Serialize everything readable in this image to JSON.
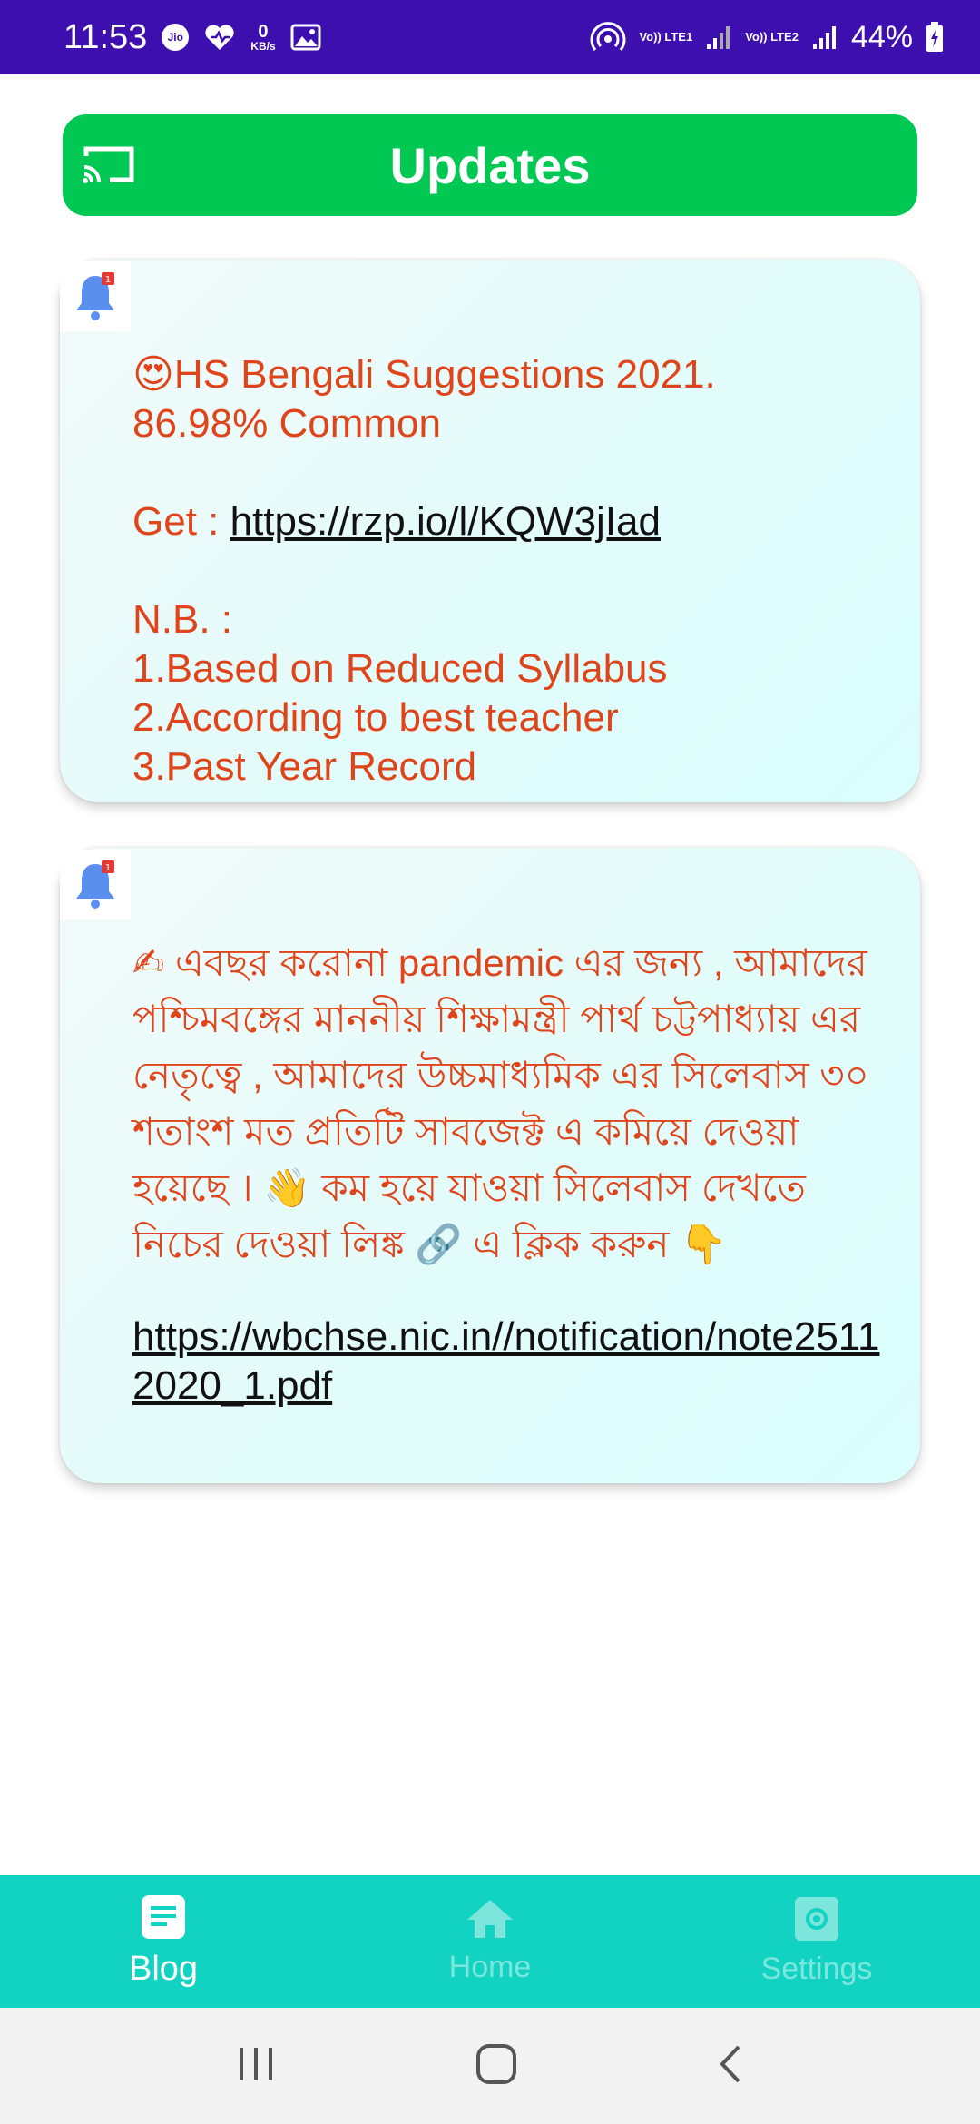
{
  "status_bar": {
    "time": "11:53",
    "jio": "Jio",
    "speed_value": "0",
    "speed_unit": "KB/s",
    "lte1": "Vo)) LTE1",
    "lte2": "Vo)) LTE2",
    "battery": "44%"
  },
  "header": {
    "title": "Updates",
    "cast_icon": "cast-icon"
  },
  "posts": [
    {
      "emoji": "😍",
      "line1": "HS Bengali Suggestions 2021.",
      "line2": "86.98% Common",
      "get_label": "Get : ",
      "link": "https://rzp.io/l/KQW3jIad",
      "nb": "N.B. :",
      "point1": "1.Based on Reduced Syllabus",
      "point2": "2.According to best teacher",
      "point3": "3.Past Year Record"
    },
    {
      "text_a": "✍ এবছর করোনা pandemic এর জন্য , আমাদের পশ্চিমবঙ্গের মাননীয় শিক্ষামন্ত্রী পার্থ চট্টপাধ্যায় এর নেতৃত্বে , আমাদের উচ্চমাধ্যমিক এর সিলেবাস ৩০ শতাংশ মত প্রতিটি সাবজেক্ট এ কমিয়ে দেওয়া হয়েছে । 👋 কম হয়ে যাওয়া সিলেবাস দেখতে নিচের দেওয়া লিঙ্ক 🔗 এ ক্লিক করুন 👇",
      "link": "https://wbchse.nic.in//notification/note25112020_1.pdf"
    }
  ],
  "bottom_nav": {
    "blog": "Blog",
    "home": "Home",
    "settings": "Settings"
  },
  "colors": {
    "status_bar": "#3d0fae",
    "header": "#00c853",
    "bottom_nav": "#12d2c2",
    "post_text": "#e0441a"
  }
}
